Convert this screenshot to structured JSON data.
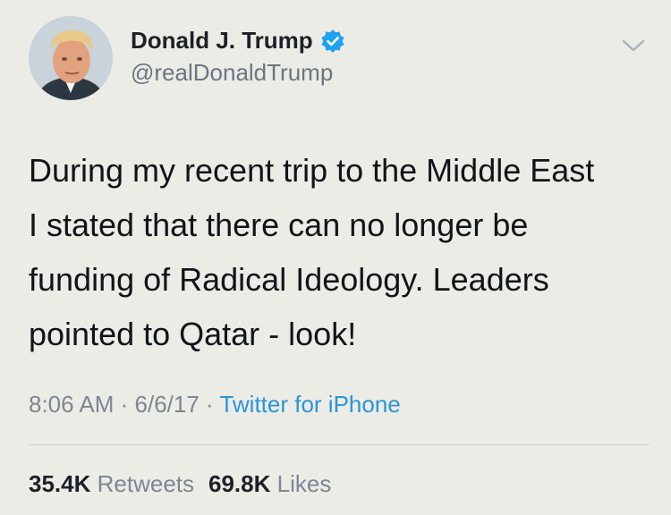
{
  "account": {
    "display_name": "Donald J. Trump",
    "handle": "@realDonaldTrump",
    "verified": true
  },
  "tweet": {
    "lines": [
      "During my recent trip to the Middle East",
      "I stated that there can no longer be",
      "funding of Radical Ideology. Leaders",
      "pointed to Qatar - look!"
    ],
    "time": "8:06 AM",
    "date": "6/6/17",
    "source": "Twitter for iPhone",
    "separator": " · "
  },
  "stats": {
    "retweets_count": "35.4K",
    "retweets_label": "Retweets",
    "likes_count": "69.8K",
    "likes_label": "Likes"
  },
  "icons": {
    "verified": "verified-badge-icon",
    "menu": "chevron-down-icon"
  },
  "colors": {
    "background": "#ecece6",
    "link_blue": "#2b95d6",
    "verified_blue": "#1da1f2"
  }
}
